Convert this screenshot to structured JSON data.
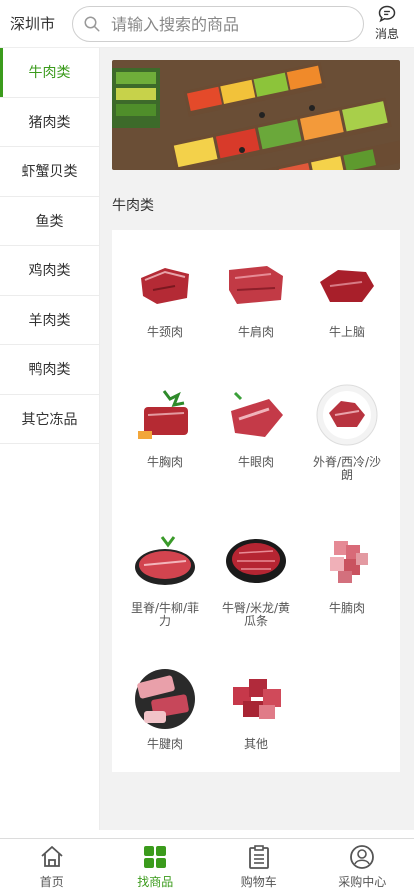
{
  "header": {
    "city": "深圳市",
    "search_placeholder": "请输入搜索的商品",
    "message_label": "消息"
  },
  "sidebar": {
    "items": [
      {
        "label": "牛肉类",
        "active": true
      },
      {
        "label": "猪肉类"
      },
      {
        "label": "虾蟹贝类"
      },
      {
        "label": "鱼类"
      },
      {
        "label": "鸡肉类"
      },
      {
        "label": "羊肉类"
      },
      {
        "label": "鸭肉类"
      },
      {
        "label": "其它冻品"
      }
    ]
  },
  "main": {
    "section_title": "牛肉类",
    "products": [
      {
        "name": "牛颈肉",
        "icon": "beef-neck-image"
      },
      {
        "name": "牛肩肉",
        "icon": "beef-shoulder-image"
      },
      {
        "name": "牛上脑",
        "icon": "beef-chuck-image"
      },
      {
        "name": "牛胸肉",
        "icon": "beef-brisket-image"
      },
      {
        "name": "牛眼肉",
        "icon": "beef-ribeye-image"
      },
      {
        "name": "外脊/西冷/沙朗",
        "icon": "beef-sirloin-image"
      },
      {
        "name": "里脊/牛柳/菲力",
        "icon": "beef-tenderloin-image"
      },
      {
        "name": "牛臀/米龙/黄瓜条",
        "icon": "beef-rump-image"
      },
      {
        "name": "牛腩肉",
        "icon": "beef-flank-image"
      },
      {
        "name": "牛腱肉",
        "icon": "beef-shank-image"
      },
      {
        "name": "其他",
        "icon": "beef-other-image"
      }
    ]
  },
  "bottom_nav": {
    "items": [
      {
        "label": "首页",
        "icon": "home-icon"
      },
      {
        "label": "找商品",
        "icon": "category-grid-icon",
        "active": true
      },
      {
        "label": "购物车",
        "icon": "clipboard-icon"
      },
      {
        "label": "采购中心",
        "icon": "user-icon"
      }
    ]
  },
  "colors": {
    "accent": "#3b9b1c"
  }
}
